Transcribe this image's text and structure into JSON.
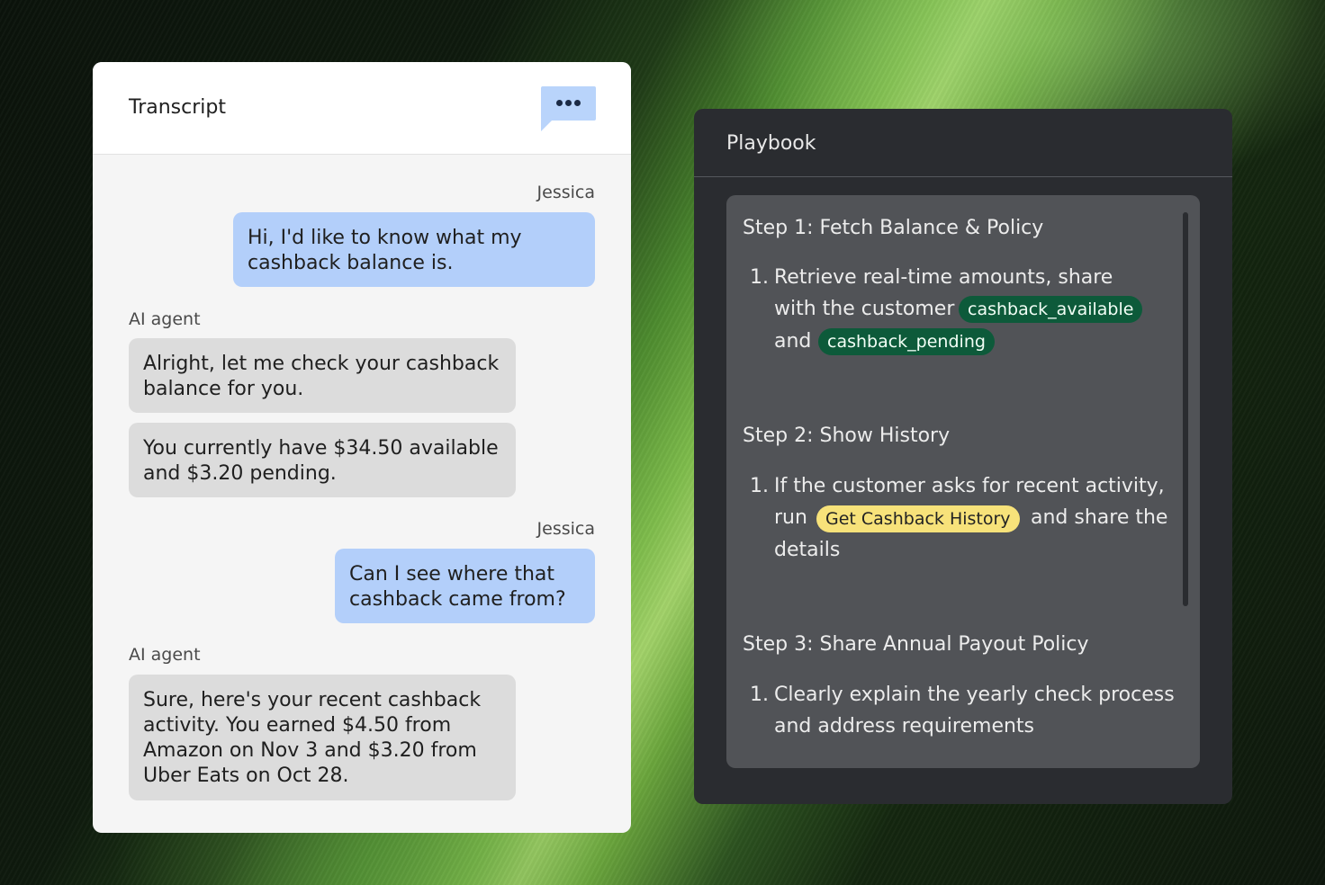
{
  "transcript": {
    "title": "Transcript",
    "messages": [
      {
        "speaker": "Jessica",
        "text": "Hi, I'd like to know what my cashback balance is."
      },
      {
        "speaker": "AI agent",
        "text": "Alright, let me check your cashback balance for you."
      },
      {
        "text": "You currently have $34.50 available and $3.20 pending."
      },
      {
        "speaker": "Jessica",
        "text": "Can I see where that cashback came from?"
      },
      {
        "speaker": "AI agent",
        "text": "Sure, here's your recent cashback activity. You earned $4.50 from Amazon on Nov 3 and $3.20 from Uber Eats on Oct 28."
      }
    ]
  },
  "playbook": {
    "title": "Playbook",
    "steps": [
      {
        "title": "Step 1: Fetch Balance & Policy",
        "num": "1.",
        "line1": "Retrieve real-time amounts, share",
        "line2": "with the customer",
        "chip1": "cashback_available",
        "line3": "and",
        "chip2": "cashback_pending"
      },
      {
        "title": "Step 2: Show History",
        "num": "1.",
        "line1": "If the customer asks for recent activity,",
        "line2a": "run",
        "chip": "Get Cashback History",
        "line2b": "and share the",
        "line3": "details"
      },
      {
        "title": "Step 3: Share Annual Payout Policy",
        "num": "1.",
        "line1": "Clearly explain the yearly check process",
        "line2": "and address requirements"
      }
    ]
  },
  "icons": {
    "transcript_menu": "chat-bubble-more-icon"
  },
  "colors": {
    "user_bubble": "#b3cffa",
    "agent_bubble": "#dcdcdc",
    "variable_chip": "#0d5a3a",
    "tool_chip": "#f7e27a"
  }
}
